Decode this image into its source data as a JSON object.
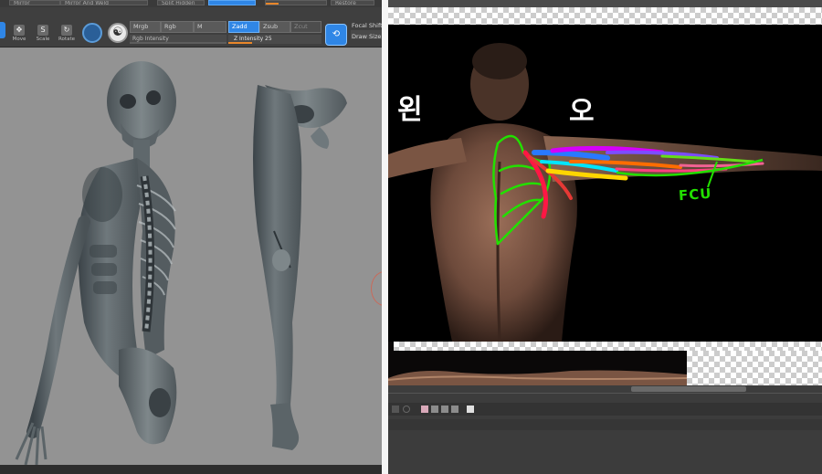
{
  "left_app": {
    "top_strip": {
      "btn_1": "Mirror",
      "btn_2": "Mirror And Weld",
      "btn_3": "Split Hidden",
      "btn_4": "",
      "btn_5": "Restore"
    },
    "tools": [
      {
        "label": "Move",
        "icon": "move-icon",
        "glyph": "✥"
      },
      {
        "label": "Scale",
        "icon": "scale-icon",
        "glyph": "S"
      },
      {
        "label": "Rotate",
        "icon": "rotate-icon",
        "glyph": "↻"
      }
    ],
    "modes": {
      "mrgb": "Mrgb",
      "rgb": "Rgb",
      "m": "M",
      "zadd": "Zadd",
      "zsub": "Zsub",
      "zcut": "Zcut"
    },
    "sliders": {
      "rgb_intensity": "Rgb Intensity",
      "z_intensity": "Z Intensity 25",
      "z_intensity_value": 25
    },
    "side": {
      "focal_shift": "Focal Shift",
      "draw_size": "Draw Size"
    },
    "accent_color": "#2f86e6",
    "slider_fill_color": "#e8862a"
  },
  "right_app": {
    "annotations": {
      "left_hangul": "왼",
      "right_hangul": "오",
      "muscle_label": "FCU"
    },
    "overlay_color": "#22e000"
  }
}
